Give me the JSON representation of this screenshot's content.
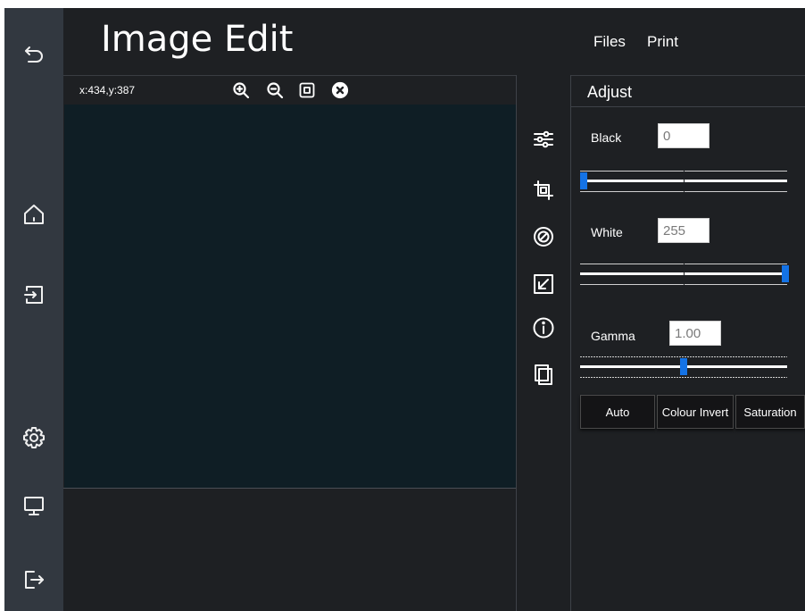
{
  "app": {
    "title": "Image Edit"
  },
  "menu": {
    "files": "Files",
    "print": "Print"
  },
  "canvas": {
    "coords": "x:434,y:387"
  },
  "adjust": {
    "title": "Adjust",
    "black": {
      "label": "Black",
      "value": "0",
      "level": 0.0
    },
    "white": {
      "label": "White",
      "value": "255",
      "level": 1.0
    },
    "gamma": {
      "label": "Gamma",
      "value": "1.00",
      "level": 0.5
    },
    "buttons": {
      "auto": "Auto",
      "invert": "Colour Invert",
      "saturation": "Saturation"
    }
  },
  "colors": {
    "rail": "#323840",
    "background": "#1e2023",
    "canvas": "#0f1e25",
    "accent": "#1473e6"
  },
  "icons": {
    "rail": [
      "back-arrow-icon",
      "home-icon",
      "import-icon",
      "settings-gear-icon",
      "monitor-icon",
      "logout-icon"
    ],
    "canvas_toolbar": [
      "zoom-in-icon",
      "zoom-out-icon",
      "fit-screen-icon",
      "close-circle-icon"
    ],
    "tools": [
      "adjust-sliders-icon",
      "crop-icon",
      "target-icon",
      "resize-icon",
      "info-icon",
      "copy-icon"
    ]
  }
}
